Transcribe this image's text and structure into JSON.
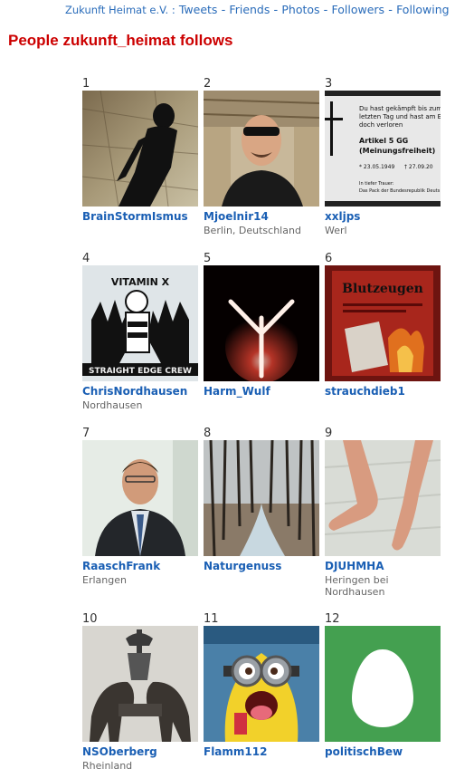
{
  "nav": {
    "owner": "Zukunft Heimat e.V. :",
    "links": [
      "Tweets",
      "Friends",
      "Photos",
      "Followers",
      "Following"
    ]
  },
  "heading": "People zukunft_heimat follows",
  "people": [
    {
      "num": "1",
      "name": "BrainStormIsmus",
      "location": ""
    },
    {
      "num": "2",
      "name": "Mjoelnir14",
      "location": "Berlin, Deutschland"
    },
    {
      "num": "3",
      "name": "xxljps",
      "location": "Werl",
      "card_text": {
        "line1": "Du hast gekämpft bis zum",
        "line2": "letzten Tag und hast am E",
        "line3": "doch verloren",
        "title1": "Artikel 5 GG",
        "title2": "(Meinungsfreiheit)",
        "born": "* 23.05.1949",
        "died": "† 27.09.20",
        "footer1": "In tiefer Trauer:",
        "footer2": "Das Pack der Bundesrepublik Deuts"
      }
    },
    {
      "num": "4",
      "name": "ChrisNordhausen",
      "location": "Nordhausen",
      "img_text": {
        "top": "VITAMIN X",
        "bottom": "STRAIGHT EDGE CREW"
      }
    },
    {
      "num": "5",
      "name": "Harm_Wulf",
      "location": ""
    },
    {
      "num": "6",
      "name": "strauchdieb1",
      "location": "",
      "img_text": {
        "top": "Blutzeugen"
      }
    },
    {
      "num": "7",
      "name": "RaaschFrank",
      "location": "Erlangen"
    },
    {
      "num": "8",
      "name": "Naturgenuss",
      "location": ""
    },
    {
      "num": "9",
      "name": "DJUHMHA",
      "location": "Heringen bei Nordhausen"
    },
    {
      "num": "10",
      "name": "NSOberberg",
      "location": "Rheinland"
    },
    {
      "num": "11",
      "name": "Flamm112",
      "location": ""
    },
    {
      "num": "12",
      "name": "politischBew",
      "location": ""
    }
  ]
}
